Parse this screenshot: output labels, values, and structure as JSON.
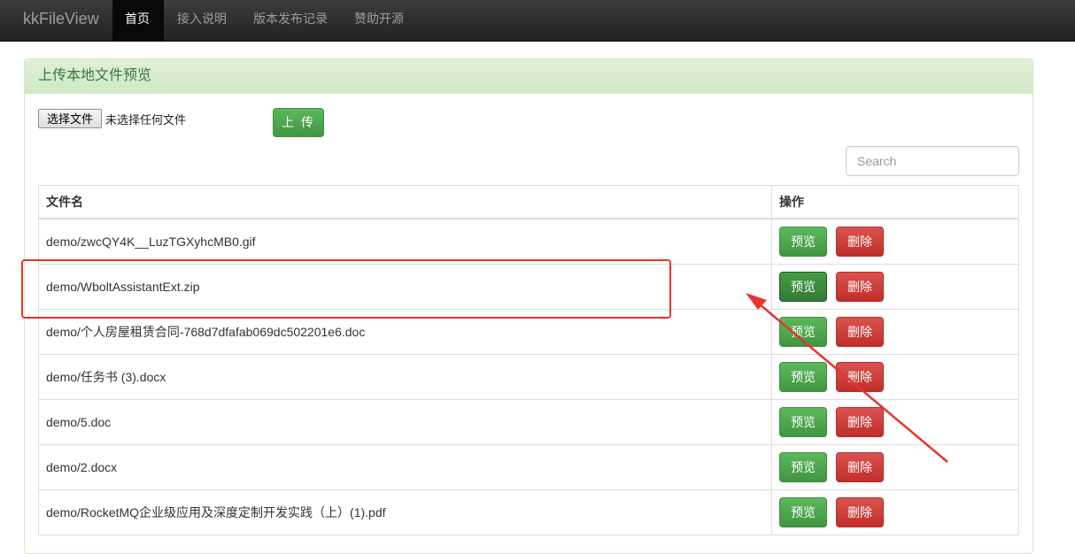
{
  "navbar": {
    "brand": "kkFileView",
    "items": [
      {
        "label": "首页",
        "active": true
      },
      {
        "label": "接入说明",
        "active": false
      },
      {
        "label": "版本发布记录",
        "active": false
      },
      {
        "label": "赞助开源",
        "active": false
      }
    ]
  },
  "panel": {
    "title": "上传本地文件预览",
    "file_button_label": "选择文件",
    "file_status": "未选择任何文件",
    "upload_label": "上 传",
    "search_placeholder": "Search"
  },
  "table": {
    "headers": {
      "name": "文件名",
      "actions": "操作"
    },
    "preview_label": "预览",
    "delete_label": "删除",
    "rows": [
      {
        "name": "demo/zwcQY4K__LuzTGXyhcMB0.gif"
      },
      {
        "name": "demo/WboltAssistantExt.zip"
      },
      {
        "name": "demo/个人房屋租赁合同-768d7dfafab069dc502201e6.doc"
      },
      {
        "name": "demo/任务书 (3).docx"
      },
      {
        "name": "demo/5.doc"
      },
      {
        "name": "demo/2.docx"
      },
      {
        "name": "demo/RocketMQ企业级应用及深度定制开发实践（上）(1).pdf"
      }
    ]
  },
  "colors": {
    "navbar_bg": "#222222",
    "success": "#5cb85c",
    "danger": "#d9534f",
    "panel_heading": "#dff0d8",
    "annotation": "#e8342c"
  }
}
